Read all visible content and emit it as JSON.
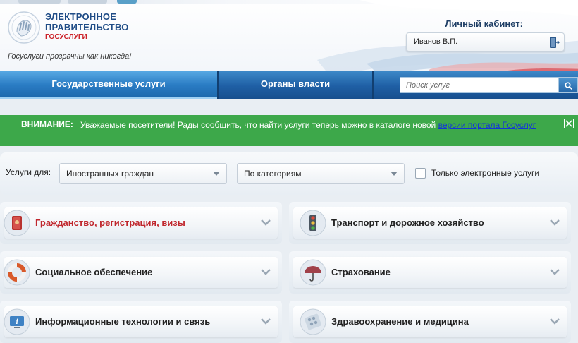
{
  "header": {
    "logo_line1": "ЭЛЕКТРОННОЕ",
    "logo_line2": "ПРАВИТЕЛЬСТВО",
    "logo_line3": "ГОСУСЛУГИ",
    "slogan": "Госуслуги прозрачны как никогда!",
    "cabinet_label": "Личный кабинет:",
    "user_name": "Иванов В.П."
  },
  "nav": {
    "tabs": [
      {
        "label": "Государственные услуги",
        "active": true
      },
      {
        "label": "Органы власти",
        "active": false
      }
    ],
    "search_placeholder": "Поиск услуг"
  },
  "alert": {
    "title": "ВНИМАНИЕ:",
    "text": "Уважаемые посетители! Рады сообщить, что найти услуги теперь можно в каталоге новой ",
    "link_text": "версии портала Госуслуг",
    "color": "#3da84a"
  },
  "filters": {
    "label": "Услуги для:",
    "audience": "Иностранных граждан",
    "grouping": "По категориям",
    "electronic_only_label": "Только электронные услуги",
    "electronic_only_checked": false
  },
  "categories": [
    {
      "title": "Гражданство, регистрация, визы",
      "icon": "passport-icon",
      "highlighted": true
    },
    {
      "title": "Транспорт и дорожное хозяйство",
      "icon": "traffic-light-icon",
      "highlighted": false
    },
    {
      "title": "Социальное обеспечение",
      "icon": "lifebuoy-icon",
      "highlighted": false
    },
    {
      "title": "Страхование",
      "icon": "umbrella-icon",
      "highlighted": false
    },
    {
      "title": "Информационные технологии и связь",
      "icon": "info-monitor-icon",
      "highlighted": false
    },
    {
      "title": "Здравоохранение и медицина",
      "icon": "pills-icon",
      "highlighted": false
    }
  ],
  "colors": {
    "brand_blue": "#1f4c86",
    "accent_red": "#cc2229",
    "nav_blue": "#1f5fa5"
  }
}
